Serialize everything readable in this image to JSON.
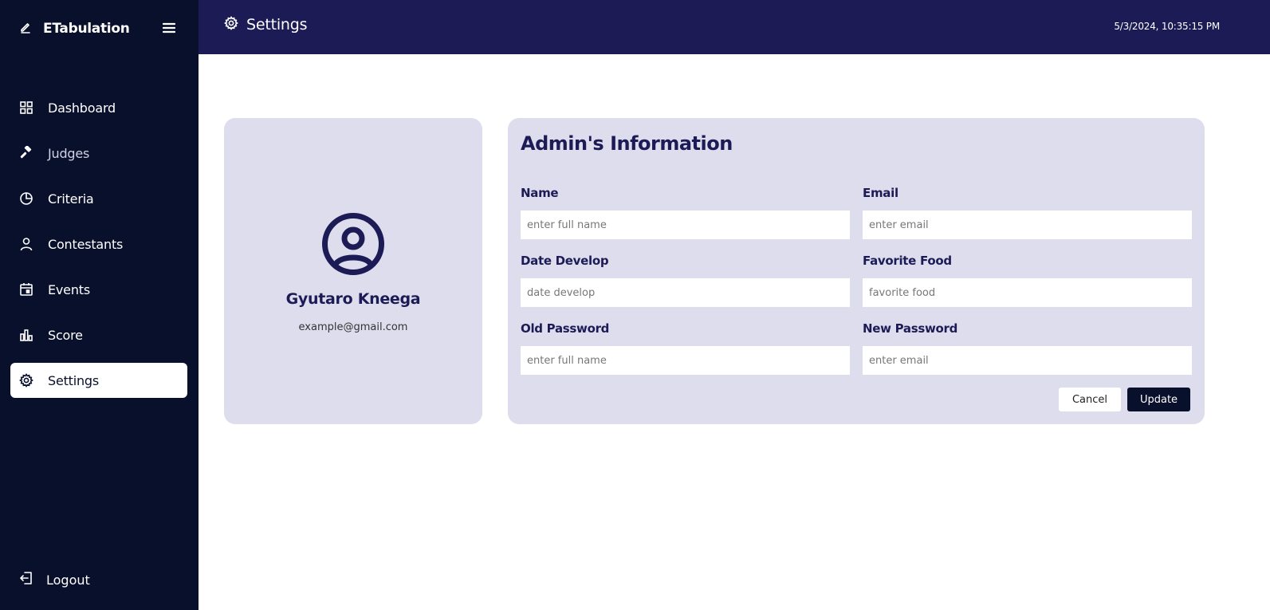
{
  "app": {
    "title": "ETabulation"
  },
  "sidebar": {
    "items": [
      {
        "label": "Dashboard",
        "icon": "grid-icon"
      },
      {
        "label": "Judges",
        "icon": "gavel-icon"
      },
      {
        "label": "Criteria",
        "icon": "pie-chart-icon"
      },
      {
        "label": "Contestants",
        "icon": "user-icon"
      },
      {
        "label": "Events",
        "icon": "calendar-icon"
      },
      {
        "label": "Score",
        "icon": "bar-chart-icon"
      },
      {
        "label": "Settings",
        "icon": "gear-icon",
        "active": true
      }
    ],
    "logout_label": "Logout"
  },
  "header": {
    "title": "Settings",
    "datetime": "5/3/2024, 10:35:15 PM"
  },
  "profile": {
    "name": "Gyutaro Kneega",
    "email": "example@gmail.com"
  },
  "form": {
    "title": "Admin's Information",
    "fields": {
      "name": {
        "label": "Name",
        "placeholder": "enter full name",
        "value": ""
      },
      "email": {
        "label": "Email",
        "placeholder": "enter email",
        "value": ""
      },
      "date_develop": {
        "label": "Date Develop",
        "placeholder": "date develop",
        "value": ""
      },
      "favorite_food": {
        "label": "Favorite Food",
        "placeholder": "favorite food",
        "value": ""
      },
      "old_password": {
        "label": "Old Password",
        "placeholder": "enter full name",
        "value": ""
      },
      "new_password": {
        "label": "New Password",
        "placeholder": "enter email",
        "value": ""
      }
    },
    "cancel_label": "Cancel",
    "update_label": "Update"
  },
  "colors": {
    "sidebar_bg": "#09102b",
    "header_bg": "#1c1b56",
    "card_bg": "#dedded",
    "accent_text": "#1c1b56"
  }
}
